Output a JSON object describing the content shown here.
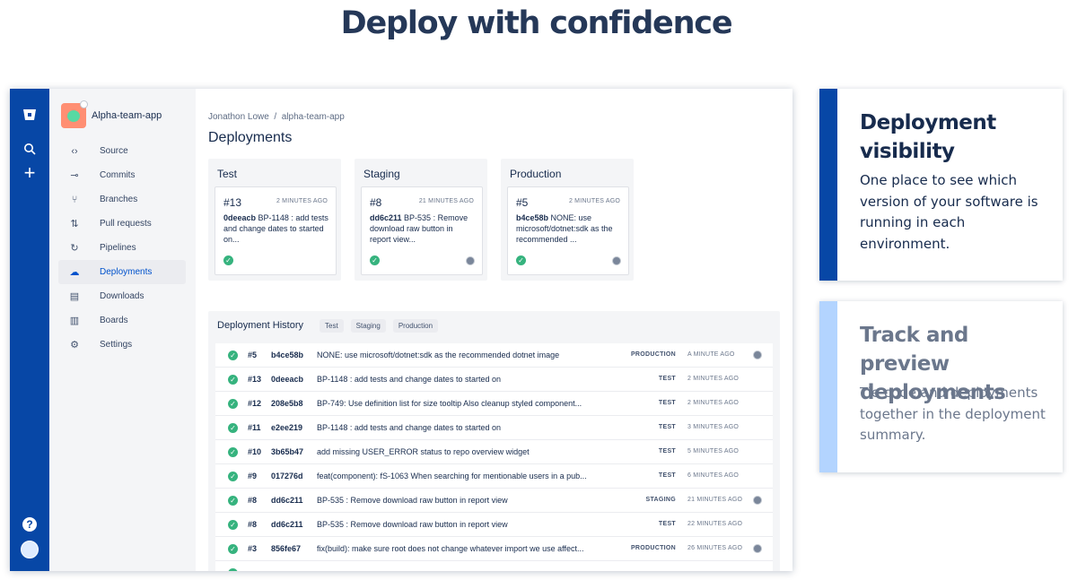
{
  "hero": {
    "title": "Deploy with confidence"
  },
  "repo": {
    "name": "Alpha-team-app"
  },
  "nav": [
    {
      "label": "Source",
      "icon": "code-icon",
      "glyph": "‹›"
    },
    {
      "label": "Commits",
      "icon": "commit-icon",
      "glyph": "⊸"
    },
    {
      "label": "Branches",
      "icon": "branch-icon",
      "glyph": "⑂"
    },
    {
      "label": "Pull requests",
      "icon": "pull-request-icon",
      "glyph": "⇅"
    },
    {
      "label": "Pipelines",
      "icon": "pipelines-icon",
      "glyph": "↻"
    },
    {
      "label": "Deployments",
      "icon": "deployments-icon",
      "glyph": "☁",
      "active": true
    },
    {
      "label": "Downloads",
      "icon": "downloads-icon",
      "glyph": "▤"
    },
    {
      "label": "Boards",
      "icon": "boards-icon",
      "glyph": "▥"
    },
    {
      "label": "Settings",
      "icon": "settings-icon",
      "glyph": "⚙"
    }
  ],
  "breadcrumb": {
    "user": "Jonathon Lowe",
    "separator": "/",
    "repo": "alpha-team-app"
  },
  "page": {
    "title": "Deployments"
  },
  "environments": [
    {
      "name": "Test",
      "number": "#13",
      "time": "2 MINUTES AGO",
      "hash": "0deeacb",
      "message": "BP-1148 : add tests and change dates to started on...",
      "avatar": false
    },
    {
      "name": "Staging",
      "number": "#8",
      "time": "21 MINUTES AGO",
      "hash": "dd6c211",
      "message": "BP-535 : Remove download raw button in report view...",
      "avatar": true
    },
    {
      "name": "Production",
      "number": "#5",
      "time": "2 MINUTES AGO",
      "hash": "b4ce58b",
      "message": "NONE: use microsoft/dotnet:sdk as the recommended ...",
      "avatar": true
    }
  ],
  "history": {
    "title": "Deployment History",
    "filters": [
      "Test",
      "Staging",
      "Production"
    ],
    "rows": [
      {
        "num": "#5",
        "hash": "b4ce58b",
        "msg": "NONE: use microsoft/dotnet:sdk as the recommended dotnet image",
        "env": "PRODUCTION",
        "time": "A MINUTE AGO",
        "avatar": true
      },
      {
        "num": "#13",
        "hash": "0deeacb",
        "msg": "BP-1148 : add tests and change dates to started on",
        "env": "TEST",
        "time": "2 MINUTES AGO",
        "avatar": false
      },
      {
        "num": "#12",
        "hash": "208e5b8",
        "msg": "BP-749: Use definition list for size tooltip Also cleanup styled component...",
        "env": "TEST",
        "time": "2 MINUTES AGO",
        "avatar": false
      },
      {
        "num": "#11",
        "hash": "e2ee219",
        "msg": "BP-1148 : add tests and change dates to started on",
        "env": "TEST",
        "time": "3 MINUTES AGO",
        "avatar": false
      },
      {
        "num": "#10",
        "hash": "3b65b47",
        "msg": "add missing USER_ERROR status to repo overview widget",
        "env": "TEST",
        "time": "5 MINUTES AGO",
        "avatar": false
      },
      {
        "num": "#9",
        "hash": "017276d",
        "msg": "feat(component): fS-1063 When searching for mentionable users in a pub...",
        "env": "TEST",
        "time": "6 MINUTES AGO",
        "avatar": false
      },
      {
        "num": "#8",
        "hash": "dd6c211",
        "msg": "BP-535 : Remove download raw button in report view",
        "env": "STAGING",
        "time": "21 MINUTES AGO",
        "avatar": true
      },
      {
        "num": "#8",
        "hash": "dd6c211",
        "msg": "BP-535 : Remove download raw button in report view",
        "env": "TEST",
        "time": "22 MINUTES AGO",
        "avatar": false
      },
      {
        "num": "#3",
        "hash": "856fe67",
        "msg": "fix(build): make sure root does not change whatever import we use affect...",
        "env": "PRODUCTION",
        "time": "26 MINUTES AGO",
        "avatar": true
      }
    ]
  },
  "panels": [
    {
      "title": "Deployment visibility",
      "body": "One place to see which version of your software is running in each environment."
    },
    {
      "title": "Track and preview deployments",
      "body": "Tie code and deployments together in the deployment summary."
    }
  ],
  "colors": {
    "rail": "#0747a6",
    "accent": "#0052cc",
    "success": "#36b37e",
    "panel_active": "#0747a6",
    "panel_inactive": "#b3d4ff"
  }
}
